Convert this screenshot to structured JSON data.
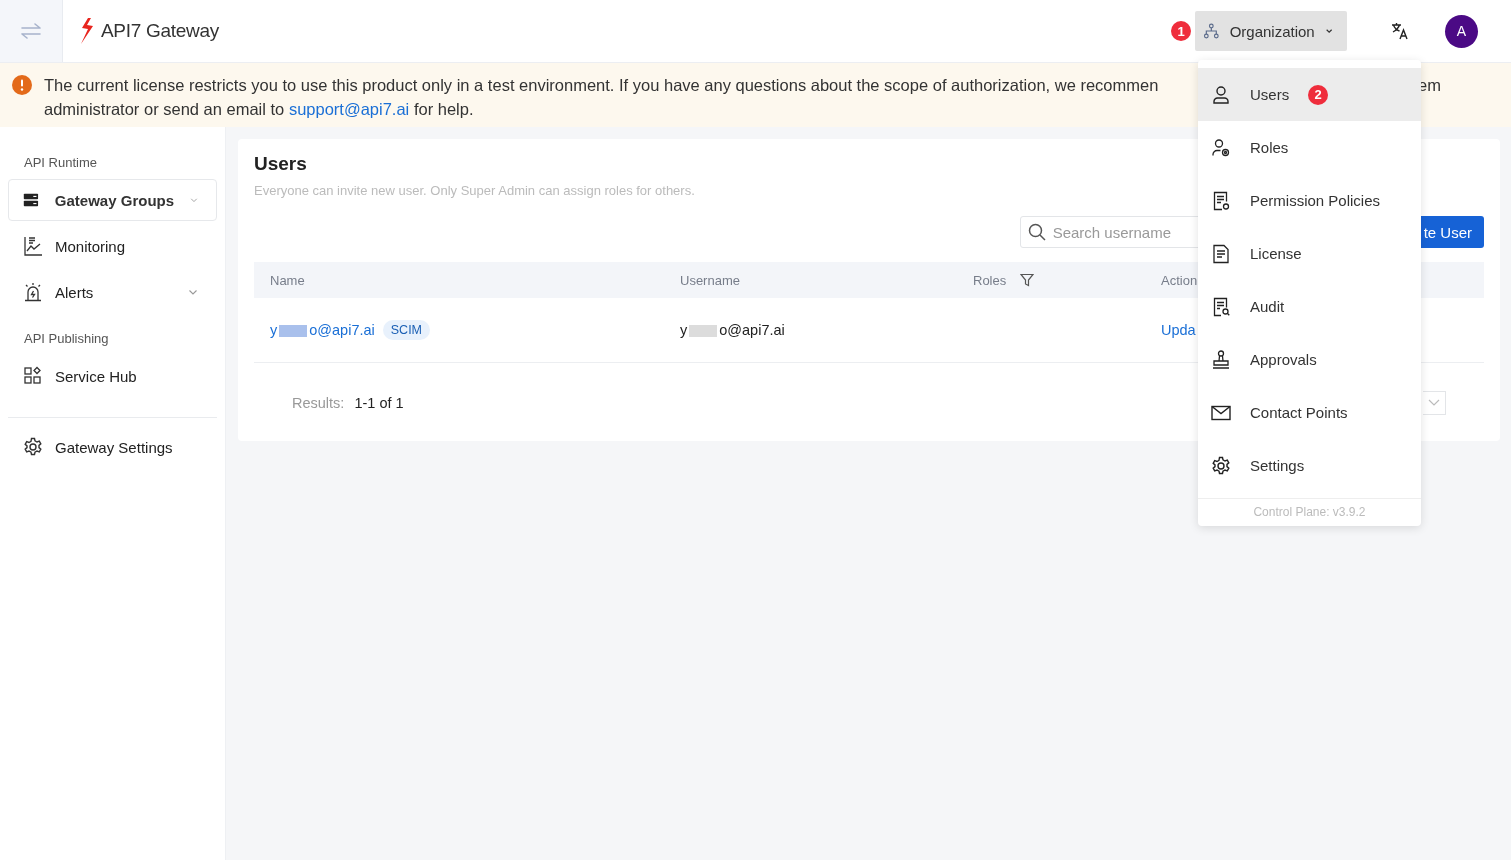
{
  "header": {
    "logo_text": "API7 Gateway",
    "org_button": {
      "label": "Organization",
      "badge": "1",
      "open": true
    },
    "avatar": "A"
  },
  "banner": {
    "line1": "The current license restricts you to use this product only in a test environment. If you have any questions about the scope of authorization, we recommen",
    "line1_tail": "em",
    "line2_before": "administrator or send an email to ",
    "link": "support@api7.ai",
    "line2_after": " for help."
  },
  "sidebar": {
    "sections": [
      {
        "heading": "API Runtime",
        "items": [
          {
            "label": "Gateway Groups",
            "expandable": true,
            "selected": true
          },
          {
            "label": "Monitoring",
            "expandable": false,
            "selected": false
          },
          {
            "label": "Alerts",
            "expandable": true,
            "selected": false
          }
        ]
      },
      {
        "heading": "API Publishing",
        "items": [
          {
            "label": "Service Hub",
            "expandable": false,
            "selected": false
          }
        ]
      },
      {
        "items": [
          {
            "label": "Gateway Settings",
            "expandable": false,
            "selected": false
          }
        ]
      }
    ]
  },
  "page": {
    "title": "Users",
    "subtitle": "Everyone can invite new user. Only Super Admin can assign roles for others.",
    "search": {
      "placeholder": "Search username"
    },
    "create_button": "te User",
    "table": {
      "columns": [
        {
          "label": "Name"
        },
        {
          "label": "Username"
        },
        {
          "label": "Roles",
          "filter": true
        },
        {
          "label": "Action"
        }
      ],
      "rows": [
        {
          "name_start": "y",
          "name_end": "o@api7.ai",
          "tag": "SCIM",
          "username_start": "y",
          "username_end": "o@api7.ai",
          "action": "Upda"
        }
      ]
    },
    "results_label": "Results:",
    "results_value": "1-1 of 1"
  },
  "dropdown": {
    "items": [
      {
        "label": "Users",
        "selected": true,
        "badge": "2"
      },
      {
        "label": "Roles",
        "selected": false
      },
      {
        "label": "Permission Policies",
        "selected": false
      },
      {
        "label": "License",
        "selected": false
      },
      {
        "label": "Audit",
        "selected": false
      },
      {
        "label": "Approvals",
        "selected": false
      },
      {
        "label": "Contact Points",
        "selected": false
      },
      {
        "label": "Settings",
        "selected": false
      }
    ],
    "footer": "Control Plane: v3.9.2"
  }
}
